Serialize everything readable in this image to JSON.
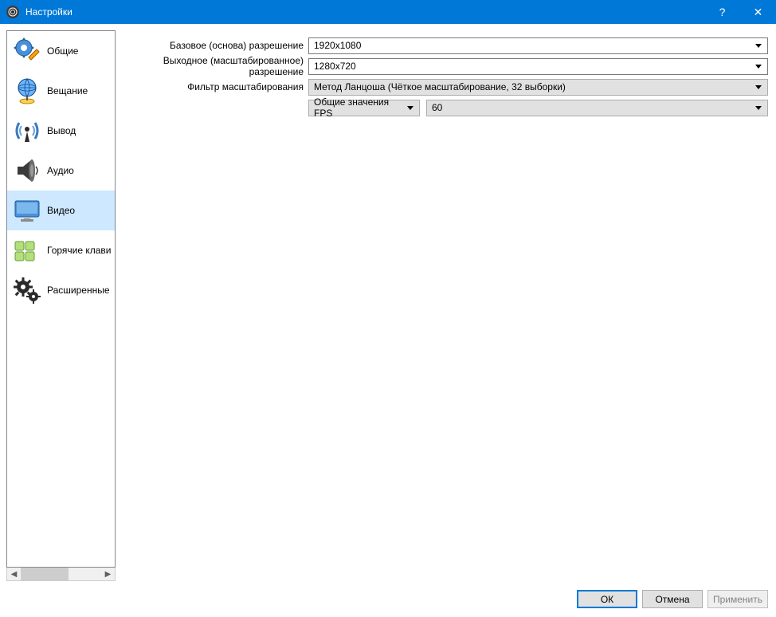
{
  "titlebar": {
    "title": "Настройки",
    "help_glyph": "?",
    "close_glyph": "✕"
  },
  "sidebar": {
    "items": [
      {
        "label": "Общие"
      },
      {
        "label": "Вещание"
      },
      {
        "label": "Вывод"
      },
      {
        "label": "Аудио"
      },
      {
        "label": "Видео"
      },
      {
        "label": "Горячие клавиши"
      },
      {
        "label": "Расширенные"
      }
    ],
    "selected_index": 4,
    "scroll_left_glyph": "◀",
    "scroll_right_glyph": "▶"
  },
  "form": {
    "rows": [
      {
        "label": "Базовое (основа) разрешение",
        "value": "1920x1080",
        "style": "white"
      },
      {
        "label": "Выходное (масштабированное) разрешение",
        "value": "1280x720",
        "style": "white"
      },
      {
        "label": "Фильтр масштабирования",
        "value": "Метод Ланцоша (Чёткое масштабирование, 32 выборки)",
        "style": "grey"
      }
    ],
    "fps": {
      "mode_label": "Общие значения FPS",
      "value": "60"
    }
  },
  "footer": {
    "ok": "ОК",
    "cancel": "Отмена",
    "apply": "Применить"
  }
}
